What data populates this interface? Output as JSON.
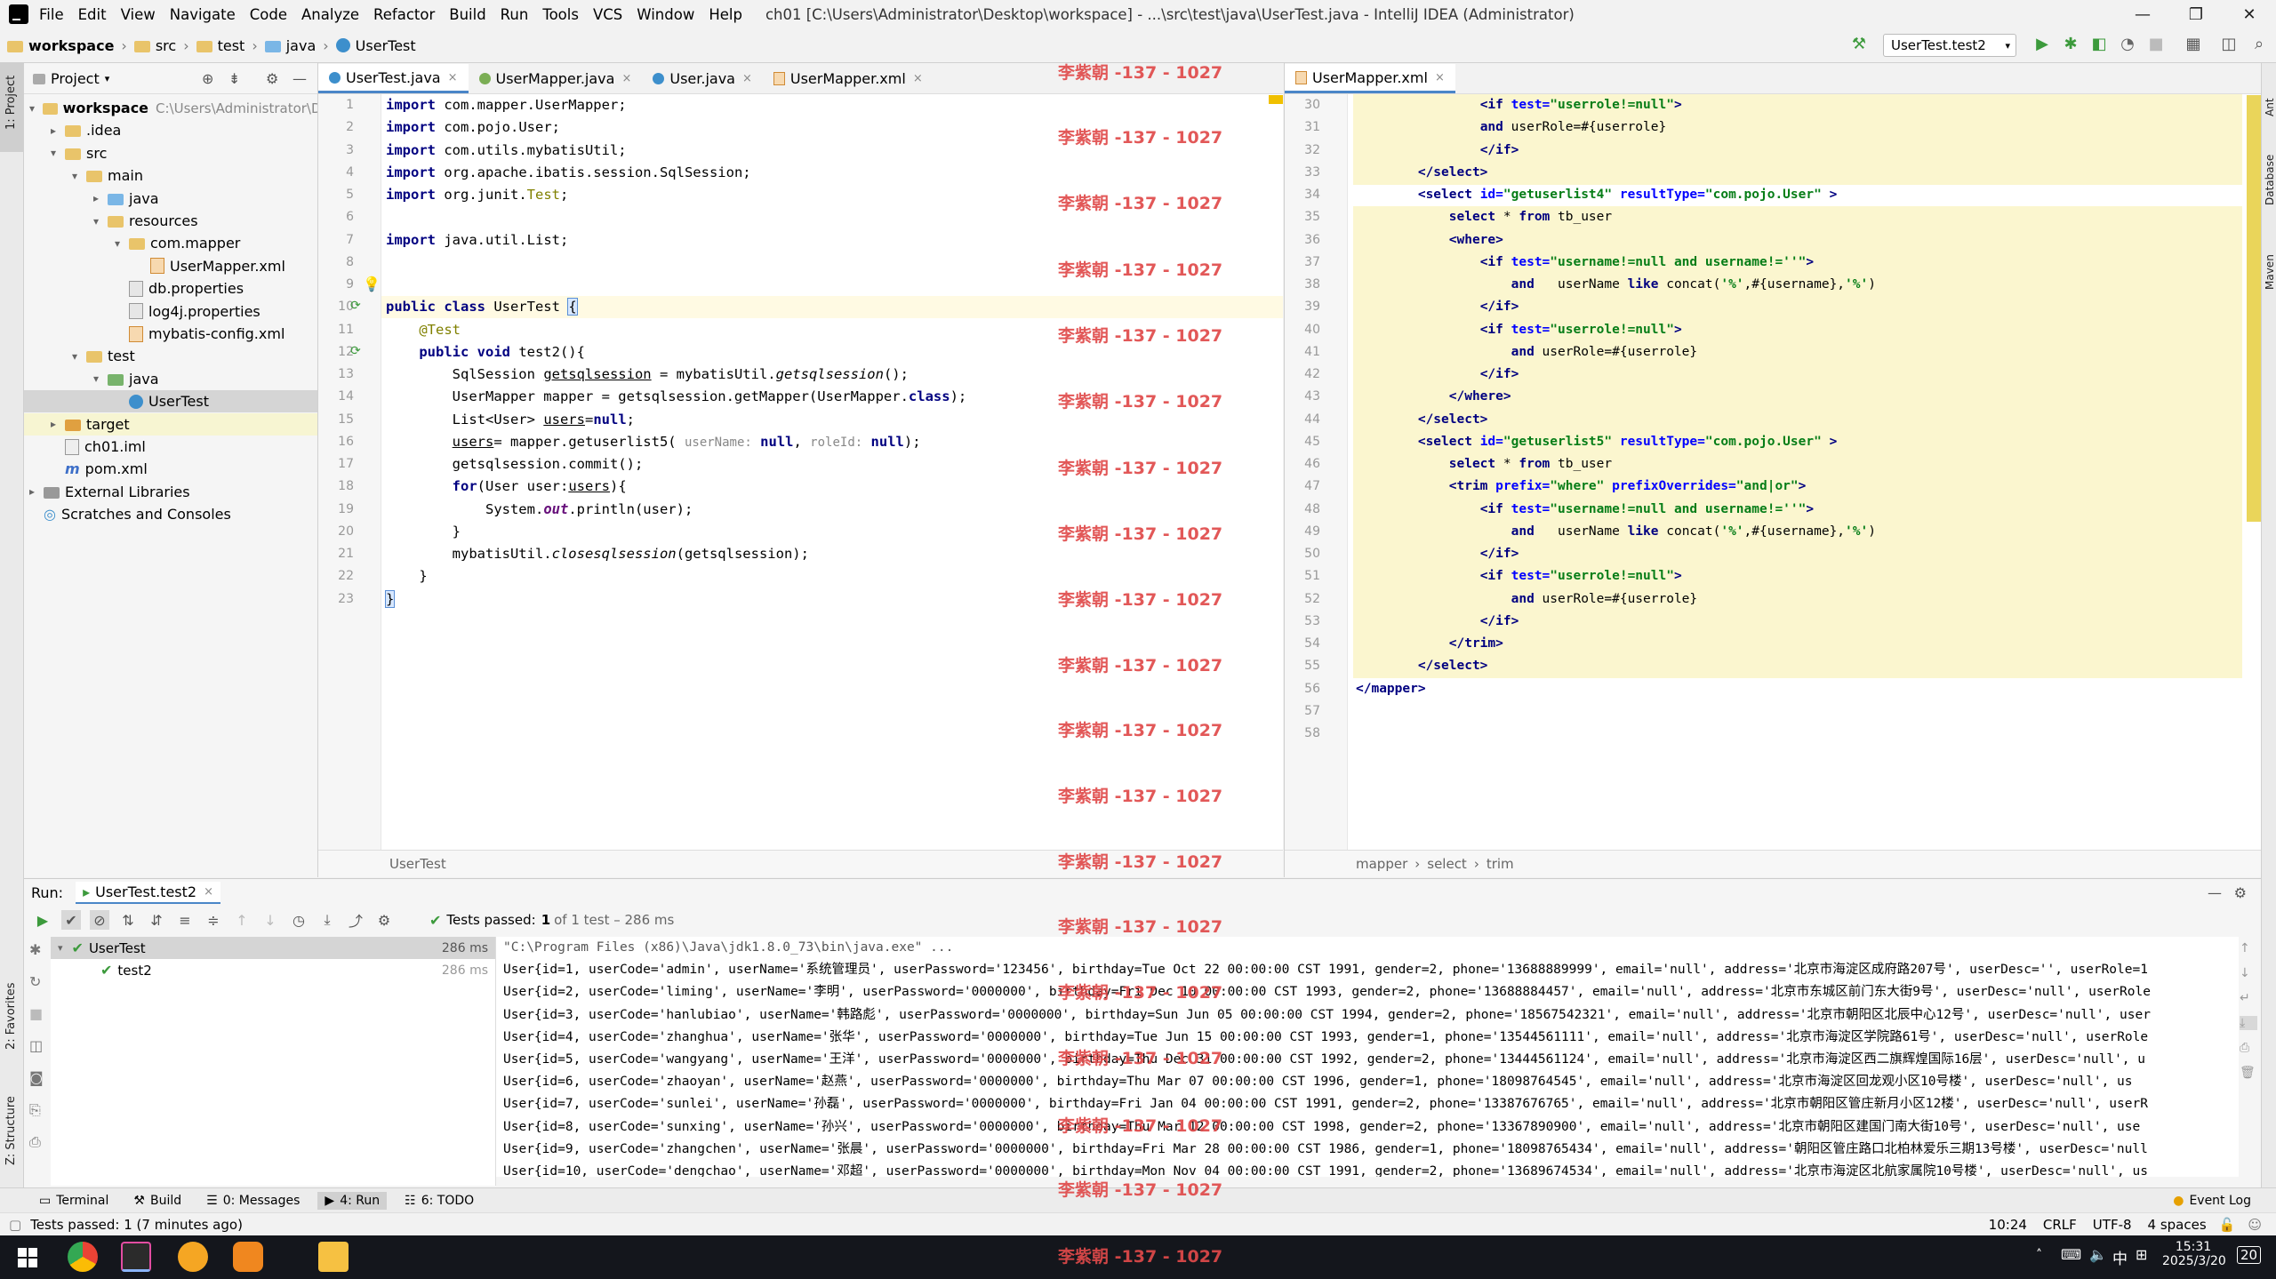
{
  "window": {
    "title": "ch01 [C:\\Users\\Administrator\\Desktop\\workspace] - ...\\src\\test\\java\\UserTest.java - IntelliJ IDEA (Administrator)",
    "minimize": "—",
    "maximize": "❐",
    "close": "✕"
  },
  "menu": [
    "File",
    "Edit",
    "View",
    "Navigate",
    "Code",
    "Analyze",
    "Refactor",
    "Build",
    "Run",
    "Tools",
    "VCS",
    "Window",
    "Help"
  ],
  "breadcrumbs": [
    "workspace",
    "src",
    "test",
    "java",
    "UserTest"
  ],
  "run_config": "UserTest.test2",
  "project_panel": {
    "title": "Project",
    "tree": [
      {
        "label": "workspace",
        "extra": "C:\\Users\\Administrator\\De",
        "depth": 0,
        "type": "folder",
        "arrow": "▾"
      },
      {
        "label": ".idea",
        "depth": 1,
        "type": "folder",
        "arrow": "▸"
      },
      {
        "label": "src",
        "depth": 1,
        "type": "folder",
        "arrow": "▾"
      },
      {
        "label": "main",
        "depth": 2,
        "type": "folder",
        "arrow": "▾"
      },
      {
        "label": "java",
        "depth": 3,
        "type": "folder-blue",
        "arrow": "▸"
      },
      {
        "label": "resources",
        "depth": 3,
        "type": "folder",
        "arrow": "▾"
      },
      {
        "label": "com.mapper",
        "depth": 4,
        "type": "folder",
        "arrow": "▾"
      },
      {
        "label": "UserMapper.xml",
        "depth": 5,
        "type": "xml",
        "arrow": ""
      },
      {
        "label": "db.properties",
        "depth": 4,
        "type": "props",
        "arrow": ""
      },
      {
        "label": "log4j.properties",
        "depth": 4,
        "type": "props",
        "arrow": ""
      },
      {
        "label": "mybatis-config.xml",
        "depth": 4,
        "type": "xml",
        "arrow": ""
      },
      {
        "label": "test",
        "depth": 2,
        "type": "folder",
        "arrow": "▾"
      },
      {
        "label": "java",
        "depth": 3,
        "type": "folder-green",
        "arrow": "▾"
      },
      {
        "label": "UserTest",
        "depth": 4,
        "type": "class",
        "arrow": ""
      },
      {
        "label": "target",
        "depth": 1,
        "type": "folder",
        "arrow": "▸"
      },
      {
        "label": "ch01.iml",
        "depth": 1,
        "type": "iml",
        "arrow": ""
      },
      {
        "label": "pom.xml",
        "depth": 1,
        "type": "maven",
        "arrow": ""
      },
      {
        "label": "External Libraries",
        "depth": 0,
        "type": "lib",
        "arrow": "▸"
      },
      {
        "label": "Scratches and Consoles",
        "depth": 0,
        "type": "scratch",
        "arrow": ""
      }
    ]
  },
  "editor1": {
    "tabs": [
      {
        "label": "UserTest.java",
        "active": true
      },
      {
        "label": "UserMapper.java",
        "active": false
      },
      {
        "label": "User.java",
        "active": false
      },
      {
        "label": "UserMapper.xml",
        "active": false
      }
    ],
    "breadcrumb": "UserTest",
    "line_numbers": [
      "1",
      "2",
      "3",
      "4",
      "5",
      "6",
      "7",
      "8",
      "9",
      "10",
      "11",
      "12",
      "13",
      "14",
      "15",
      "16",
      "17",
      "18",
      "19",
      "20",
      "21",
      "22",
      "23"
    ]
  },
  "editor2": {
    "tab": "UserMapper.xml",
    "breadcrumb": [
      "mapper",
      "select",
      "trim"
    ],
    "line_numbers": [
      "30",
      "31",
      "32",
      "33",
      "34",
      "35",
      "36",
      "37",
      "38",
      "39",
      "40",
      "41",
      "42",
      "43",
      "44",
      "45",
      "46",
      "47",
      "48",
      "49",
      "50",
      "51",
      "52",
      "53",
      "54",
      "55",
      "56",
      "57",
      "58"
    ]
  },
  "run_panel": {
    "label": "Run:",
    "tab": "UserTest.test2",
    "status": "Tests passed:",
    "status_count": "1",
    "status_detail": "of 1 test – 286 ms",
    "tree": [
      {
        "label": "UserTest",
        "time": "286 ms"
      },
      {
        "label": "test2",
        "time": "286 ms"
      }
    ],
    "console": [
      "\"C:\\Program Files (x86)\\Java\\jdk1.8.0_73\\bin\\java.exe\" ...",
      "User{id=1, userCode='admin', userName='系统管理员', userPassword='123456', birthday=Tue Oct 22 00:00:00 CST 1991, gender=2, phone='13688889999', email='null', address='北京市海淀区成府路207号', userDesc='', userRole=1",
      "User{id=2, userCode='liming', userName='李明', userPassword='0000000', birthday=Fri Dec 10 00:00:00 CST 1993, gender=2, phone='13688884457', email='null', address='北京市东城区前门东大街9号', userDesc='null', userRole",
      "User{id=3, userCode='hanlubiao', userName='韩路彪', userPassword='0000000', birthday=Sun Jun 05 00:00:00 CST 1994, gender=2, phone='18567542321', email='null', address='北京市朝阳区北辰中心12号', userDesc='null', user",
      "User{id=4, userCode='zhanghua', userName='张华', userPassword='0000000', birthday=Tue Jun 15 00:00:00 CST 1993, gender=1, phone='13544561111', email='null', address='北京市海淀区学院路61号', userDesc='null', userRole",
      "User{id=5, userCode='wangyang', userName='王洋', userPassword='0000000', birthday=Thu Dec 31 00:00:00 CST 1992, gender=2, phone='13444561124', email='null', address='北京市海淀区西二旗辉煌国际16层', userDesc='null', u",
      "User{id=6, userCode='zhaoyan', userName='赵燕', userPassword='0000000', birthday=Thu Mar 07 00:00:00 CST 1996, gender=1, phone='18098764545', email='null', address='北京市海淀区回龙观小区10号楼', userDesc='null', us",
      "User{id=7, userCode='sunlei', userName='孙磊', userPassword='0000000', birthday=Fri Jan 04 00:00:00 CST 1991, gender=2, phone='13387676765', email='null', address='北京市朝阳区管庄新月小区12楼', userDesc='null', userR",
      "User{id=8, userCode='sunxing', userName='孙兴', userPassword='0000000', birthday=Thu Mar 12 00:00:00 CST 1998, gender=2, phone='13367890900', email='null', address='北京市朝阳区建国门南大街10号', userDesc='null', use",
      "User{id=9, userCode='zhangchen', userName='张晨', userPassword='0000000', birthday=Fri Mar 28 00:00:00 CST 1986, gender=1, phone='18098765434', email='null', address='朝阳区管庄路口北柏林爱乐三期13号楼', userDesc='null",
      "User{id=10, userCode='dengchao', userName='邓超', userPassword='0000000', birthday=Mon Nov 04 00:00:00 CST 1991, gender=2, phone='13689674534', email='null', address='北京市海淀区北航家属院10号楼', userDesc='null', us"
    ]
  },
  "bottom_tools": [
    {
      "label": "Terminal",
      "active": false
    },
    {
      "label": "Build",
      "active": false
    },
    {
      "label": "0: Messages",
      "active": false
    },
    {
      "label": "4: Run",
      "active": true
    },
    {
      "label": "6: TODO",
      "active": false
    }
  ],
  "event_log": "Event Log",
  "status_bar": {
    "message": "Tests passed: 1 (7 minutes ago)",
    "position": "10:24",
    "line_sep": "CRLF",
    "encoding": "UTF-8",
    "indent": "4 spaces"
  },
  "left_stripe": [
    "1: Project",
    "2: Favorites",
    "Z: Structure"
  ],
  "right_stripe": [
    "Ant",
    "Database",
    "Maven"
  ],
  "taskbar": {
    "time": "15:31",
    "date": "2025/3/20",
    "ime": "中",
    "notif": "20"
  },
  "watermark": "李紫朝 -137 - 1027",
  "colors": {
    "accent": "#4a86c8",
    "watermark": "#e04a4a",
    "xml_highlight": "#fbf6cf",
    "test_pass": "#3c9a3c"
  }
}
